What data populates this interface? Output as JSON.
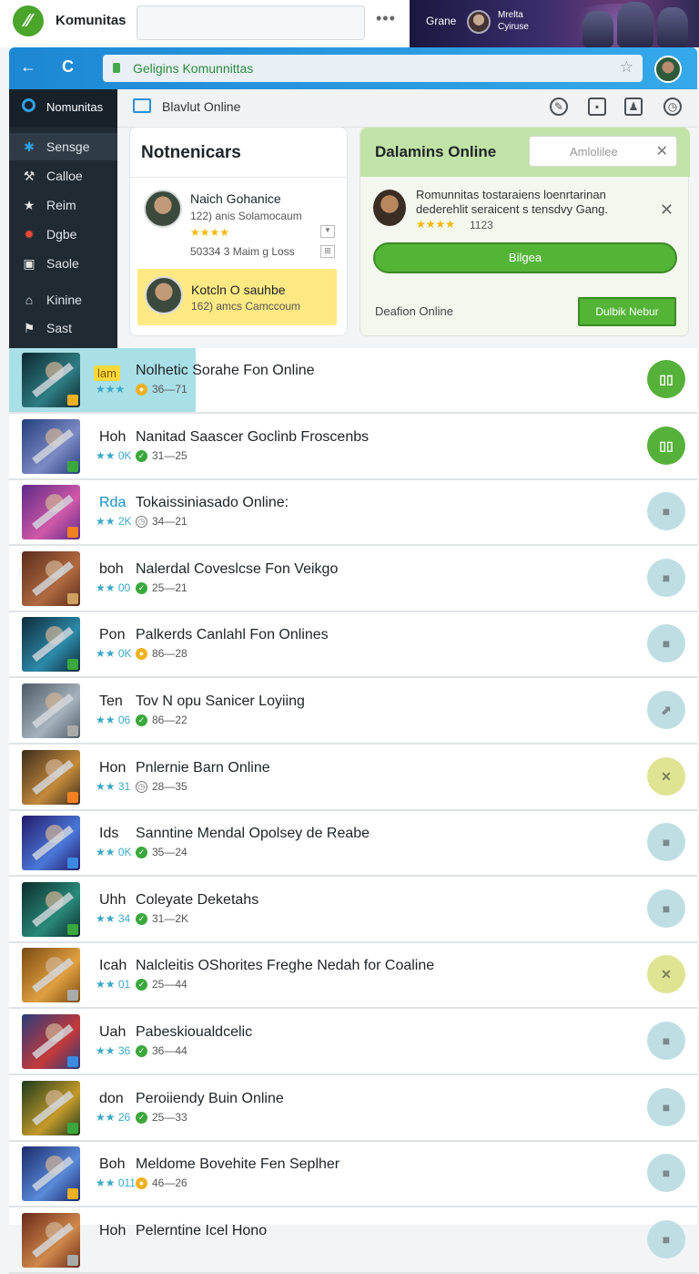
{
  "topbar": {
    "app_name": "Komunitas",
    "logo_glyph": "⁄⁄",
    "more_glyph": "•••",
    "banner": {
      "label": "Grane",
      "user_line1": "Mrelta",
      "user_line2": "Cyiruse"
    }
  },
  "browser": {
    "back_glyph": "←",
    "reload_glyph": "C",
    "url": "Geligins Komunnittas",
    "star_glyph": "☆"
  },
  "sidebar": {
    "header": "Nomunitas",
    "items": [
      {
        "label": "Sensge",
        "icon": "star-burst-icon",
        "glyph": "✱"
      },
      {
        "label": "Calloe",
        "icon": "hammer-icon",
        "glyph": "⚒"
      },
      {
        "label": "Reim",
        "icon": "star-icon",
        "glyph": "★"
      },
      {
        "label": "Dgbe",
        "icon": "burst-icon",
        "glyph": "✹"
      },
      {
        "label": "Saole",
        "icon": "square-icon",
        "glyph": "▣"
      },
      {
        "label": "Kinine",
        "icon": "building-icon",
        "glyph": "⌂"
      },
      {
        "label": "Sast",
        "icon": "flag-icon",
        "glyph": "⚑"
      }
    ]
  },
  "subheader": {
    "title": "Blavlut Online",
    "tools": [
      {
        "icon": "edit-icon",
        "glyph": "✎"
      },
      {
        "icon": "square-icon",
        "glyph": "▪"
      },
      {
        "icon": "user-icon",
        "glyph": "♟"
      },
      {
        "icon": "clock-icon",
        "glyph": "◷"
      }
    ]
  },
  "card_left": {
    "title": "Notnenicars",
    "person": {
      "name": "Naich Gohanice",
      "sub": "122) anis Solamocaum",
      "stars": "★★★★",
      "meta": "50334 3 Maim g Loss"
    },
    "highlight": {
      "name": "Kotcln O sauhbe",
      "sub": "162) amcs Camccoum"
    }
  },
  "card_right": {
    "title": "Dalamins Online",
    "search_placeholder": "Amlolilee",
    "clear_glyph": "✕",
    "message": "Romunnitas tostaraiens loenrtarinan dederehlit seraicent s tensdvy Gang.",
    "stars": "★★★★",
    "stars_count": "1123",
    "dismiss_glyph": "✕",
    "primary_button": "Bilgea",
    "footer_label": "Deafion Online",
    "footer_button": "Dulbik Nebur"
  },
  "list": [
    {
      "prefix": "lam",
      "title": "Nolhetic  Sorahe Fon Online",
      "stat": "★★★",
      "icon": "coin",
      "meta": "36—71",
      "action": "g",
      "action_glyph": "▯▯",
      "colors": [
        "#0c2830",
        "#2f7d84"
      ]
    },
    {
      "prefix": "Hoh",
      "title": "Nanitad Saascer Goclinb Froscenbs",
      "stat": "★★ 0K",
      "icon": "ok",
      "meta": "31—25",
      "action": "g",
      "action_glyph": "▯▯",
      "colors": [
        "#243e7e",
        "#7c8ac4"
      ]
    },
    {
      "prefix": "Rda",
      "title": "Tokaissiniasado Online:",
      "stat": "★★ 2K",
      "icon": "clock",
      "meta": "34—21",
      "action": "b",
      "action_glyph": "■",
      "colors": [
        "#5c2a86",
        "#d058a8"
      ]
    },
    {
      "prefix": "boh",
      "title": "Nalerdal Coveslcse Fon Veikgo",
      "stat": "★★ 00",
      "icon": "ok",
      "meta": "25—21",
      "action": "b",
      "action_glyph": "■",
      "colors": [
        "#5a2c1c",
        "#b06a40"
      ]
    },
    {
      "prefix": "Pon",
      "title": "Palkerds Canlahl Fon Onlines",
      "stat": "★★ 0K",
      "icon": "warn",
      "meta": "86—28",
      "action": "b",
      "action_glyph": "■",
      "colors": [
        "#0e2a3a",
        "#2c8aa8"
      ]
    },
    {
      "prefix": "Ten",
      "title": "Tov N opu Sanicer Loyiing",
      "stat": "★★ 06",
      "icon": "ok",
      "meta": "86—22",
      "action": "b",
      "action_glyph": "⬈",
      "colors": [
        "#4d5a66",
        "#a6b2bc"
      ]
    },
    {
      "prefix": "Hon",
      "title": "Pnlernie Barn Online",
      "stat": "★★ 31",
      "icon": "clock",
      "meta": "28—35",
      "action": "y",
      "action_glyph": "✕",
      "colors": [
        "#3c2c1c",
        "#c48a3c"
      ]
    },
    {
      "prefix": "Ids",
      "title": "Sanntine Mendal Opolsey de Reabe",
      "stat": "★★ 0K",
      "icon": "ok",
      "meta": "35—24",
      "action": "b",
      "action_glyph": "■",
      "colors": [
        "#241a6a",
        "#4a78d8"
      ]
    },
    {
      "prefix": "Uhh",
      "title": "Coleyate Deketahs",
      "stat": "★★ 34",
      "icon": "ok",
      "meta": "31—2K",
      "action": "b",
      "action_glyph": "■",
      "colors": [
        "#0c2c2c",
        "#2a8a7a"
      ]
    },
    {
      "prefix": "Icah",
      "title": "Nalcleitis OShorites Freghe Nedah for Coaline",
      "stat": "★★ 01",
      "icon": "ok",
      "meta": "25—44",
      "action": "y",
      "action_glyph": "✕",
      "colors": [
        "#7a4a10",
        "#e0a040"
      ]
    },
    {
      "prefix": "Uah",
      "title": "Pabeskioualdcelic",
      "stat": "★★ 36",
      "icon": "ok",
      "meta": "36—44",
      "action": "b",
      "action_glyph": "■",
      "colors": [
        "#2a3c7a",
        "#c43a3a"
      ]
    },
    {
      "prefix": "don",
      "title": "Peroiiendy Buin Online",
      "stat": "★★ 26",
      "icon": "ok",
      "meta": "25—33",
      "action": "b",
      "action_glyph": "■",
      "colors": [
        "#1c3a1c",
        "#c49a2a"
      ]
    },
    {
      "prefix": "Boh",
      "title": "Meldome Bovehite Fen Seplher",
      "stat": "★★ 011",
      "icon": "warn",
      "meta": "46—26",
      "action": "b",
      "action_glyph": "■",
      "colors": [
        "#1a2a6a",
        "#5a8ad8"
      ]
    },
    {
      "prefix": "Hoh",
      "title": "Pelerntine Icel Hono",
      "stat": "",
      "icon": "",
      "meta": "",
      "action": "b",
      "action_glyph": "■",
      "colors": [
        "#6a2a1a",
        "#d0884a"
      ]
    }
  ]
}
